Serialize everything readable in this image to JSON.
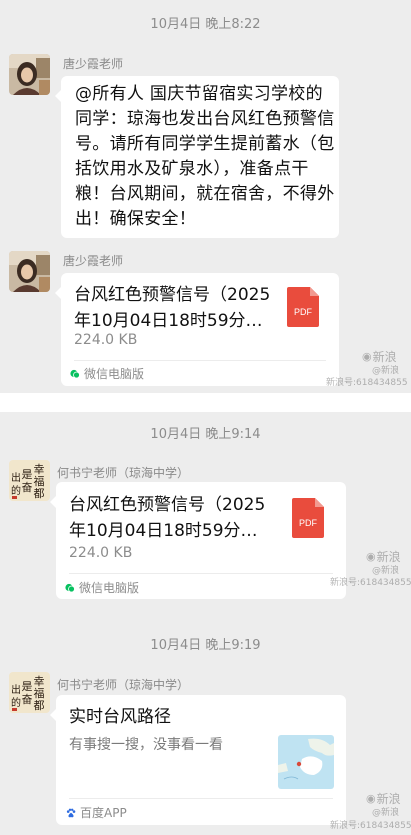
{
  "screenshot_1": {
    "timestamp": "10月4日 晚上8:22",
    "messages": [
      {
        "sender": "唐少霞老师",
        "text_lines": [
          "@所有人  国庆节留宿实习学校的",
          "同学：琼海也发出台风红色预警信",
          "号。请所有同学学生提前蓄水（包",
          "括饮用水及矿泉水），准备点干",
          "粮！台风期间，就在宿舍，不得外",
          "出！确保安全！"
        ]
      },
      {
        "sender": "唐少霞老师",
        "file": {
          "title_lines": [
            "台风红色预警信号（2025",
            "年10月04日18时59分…"
          ],
          "size": "224.0 KB",
          "icon_label": "PDF",
          "source": "微信电脑版"
        }
      }
    ],
    "watermark": {
      "logo_text": "新浪",
      "line1": "@新浪",
      "line2": "新浪号:618434855"
    }
  },
  "screenshot_2": {
    "messages": [
      {
        "timestamp": "10月4日 晚上9:14",
        "sender": "何书宁老师（琼海中学）",
        "file": {
          "title_lines": [
            "台风红色预警信号（2025",
            "年10月04日18时59分…"
          ],
          "size": "224.0 KB",
          "icon_label": "PDF",
          "source": "微信电脑版"
        }
      },
      {
        "timestamp": "10月4日 晚上9:19",
        "sender": "何书宁老师（琼海中学）",
        "link": {
          "title": "实时台风路径",
          "description": "有事搜一搜，没事看一看",
          "source": "百度APP"
        }
      }
    ],
    "watermarks": [
      {
        "logo_text": "新浪",
        "line1": "@新浪",
        "line2": "新浪号:618434855"
      },
      {
        "logo_text": "新浪",
        "line1": "@新浪",
        "line2": "新浪号:618434855"
      }
    ]
  },
  "colors": {
    "chat_bg": "#ededed",
    "divider": "#ffffff",
    "bubble": "#ffffff",
    "pdf_red": "#e94c3d",
    "wechat_green": "#07c160",
    "baidu_blue": "#2d6be0"
  },
  "icons": [
    "teacher-avatar-icon",
    "calligraphy-avatar-icon",
    "pdf-file-icon",
    "wechat-pc-icon",
    "baidu-app-icon",
    "map-thumbnail-icon",
    "sina-logo-icon"
  ]
}
